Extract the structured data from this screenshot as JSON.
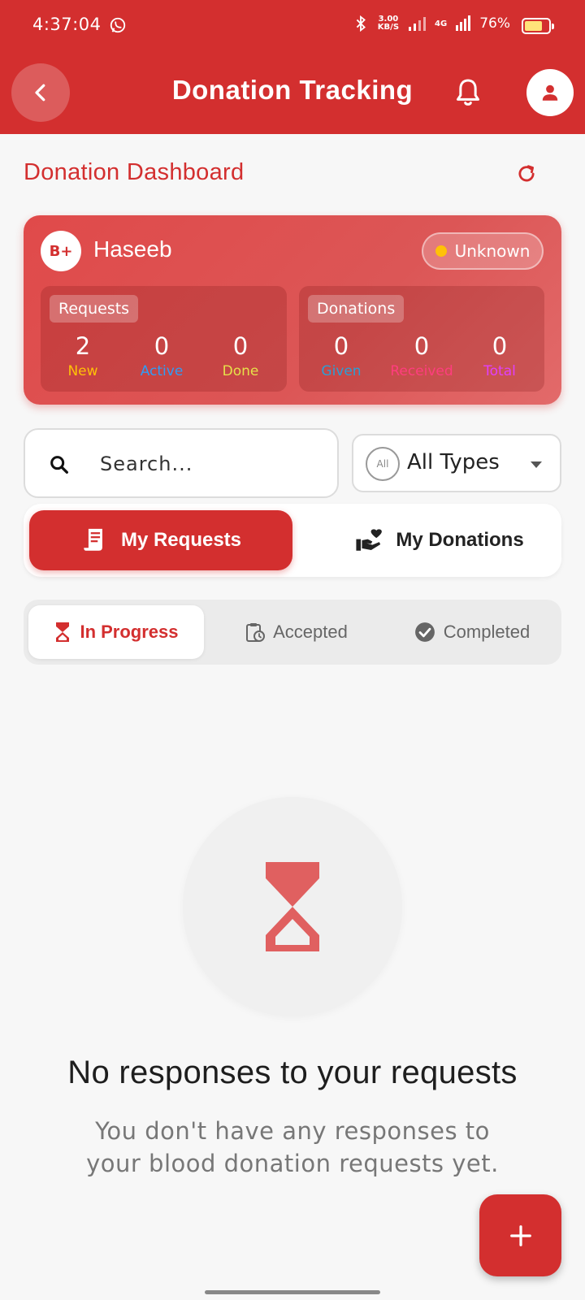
{
  "status_bar": {
    "time": "4:37:04",
    "net_speed_value": "3.00",
    "net_speed_unit": "KB/S",
    "network": "4G",
    "battery_percent": "76%",
    "battery_level": 0.76
  },
  "app_bar": {
    "title": "Donation Tracking"
  },
  "dashboard": {
    "title": "Donation Dashboard"
  },
  "user_card": {
    "blood_type": "B+",
    "name": "Haseeb",
    "status": "Unknown",
    "requests": {
      "label": "Requests",
      "stats": [
        {
          "value": "2",
          "label": "New",
          "color": "#ffc107"
        },
        {
          "value": "0",
          "label": "Active",
          "color": "#2f9cf5"
        },
        {
          "value": "0",
          "label": "Done",
          "color": "#e6e04a"
        }
      ]
    },
    "donations": {
      "label": "Donations",
      "stats": [
        {
          "value": "0",
          "label": "Given",
          "color": "#2a9fd6"
        },
        {
          "value": "0",
          "label": "Received",
          "color": "#ff3d7f"
        },
        {
          "value": "0",
          "label": "Total",
          "color": "#e040fb"
        }
      ]
    }
  },
  "search": {
    "placeholder": "Search..."
  },
  "type_filter": {
    "badge": "All",
    "selected": "All Types"
  },
  "segment": {
    "my_requests": "My Requests",
    "my_donations": "My Donations"
  },
  "tabs": {
    "in_progress": "In Progress",
    "accepted": "Accepted",
    "completed": "Completed"
  },
  "empty_state": {
    "title": "No responses to your requests",
    "subtitle": "You don't have any responses to your blood donation requests yet."
  },
  "colors": {
    "primary": "#d32f2f",
    "background": "#f7f7f7",
    "hourglass": "#e06060"
  }
}
